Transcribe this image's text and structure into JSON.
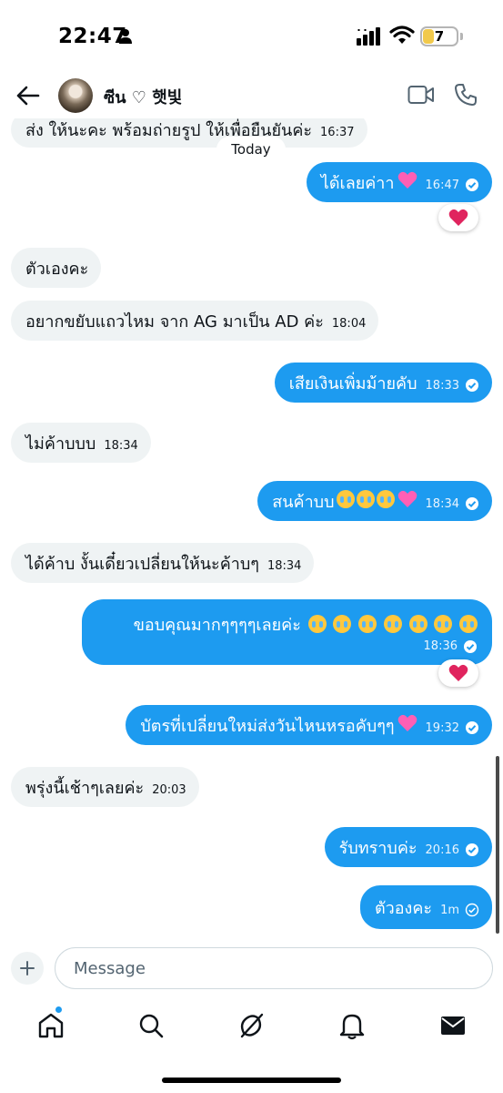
{
  "status_bar": {
    "time": "22:47",
    "battery": "7"
  },
  "header": {
    "contact_name": "ซีน ♡ 햇빛"
  },
  "chat": {
    "partial_message": {
      "text": "ส่ง ให้นะคะ พร้อมถ่ายรูป ให้เพื่อยืนยันค่ะ",
      "time": "16:37"
    },
    "date_separator": "Today",
    "messages": [
      {
        "dir": "out",
        "text": "ได้เลยค่าา",
        "time": "16:47"
      },
      {
        "dir": "in",
        "text": "ตัวเองคะ",
        "time": ""
      },
      {
        "dir": "in",
        "text": "อยากขยับแถวไหม จาก AG มาเป็น AD ค่ะ",
        "time": "18:04"
      },
      {
        "dir": "out",
        "text": "เสียเงินเพิ่มม้ายคับ",
        "time": "18:33"
      },
      {
        "dir": "in",
        "text": "ไม่ค้าบบบ",
        "time": "18:34"
      },
      {
        "dir": "out",
        "text": "สนค้าบบ",
        "time": "18:34"
      },
      {
        "dir": "in",
        "text": "ได้ค้าบ งั้นเดี๋ยวเปลี่ยนให้นะค้าบๆ",
        "time": "18:34"
      },
      {
        "dir": "out",
        "text": "ขอบคุณมากๆๆๆๆเลยค่ะ",
        "time": "18:36"
      },
      {
        "dir": "out",
        "text": "บัตรที่เปลี่ยนใหม่ส่งวันไหนหรอคับๆๆ",
        "time": "19:32"
      },
      {
        "dir": "in",
        "text": "พรุ่งนี้เช้าๆเลยค่ะ",
        "time": "20:03"
      },
      {
        "dir": "out",
        "text": "รับทราบค่ะ",
        "time": "20:16"
      },
      {
        "dir": "out",
        "text": "ตัวองคะ",
        "time": "1m"
      }
    ]
  },
  "composer": {
    "placeholder": "Message"
  },
  "colors": {
    "accent": "#1d9bf0",
    "incoming_bubble": "#eff3f4",
    "reaction_heart": "#e0245e"
  },
  "icons": [
    "back-arrow-icon",
    "video-call-icon",
    "phone-call-icon",
    "checkmark-icon",
    "heart-reaction-icon",
    "plus-icon",
    "home-icon",
    "search-icon",
    "grok-icon",
    "bell-icon",
    "mail-icon"
  ]
}
